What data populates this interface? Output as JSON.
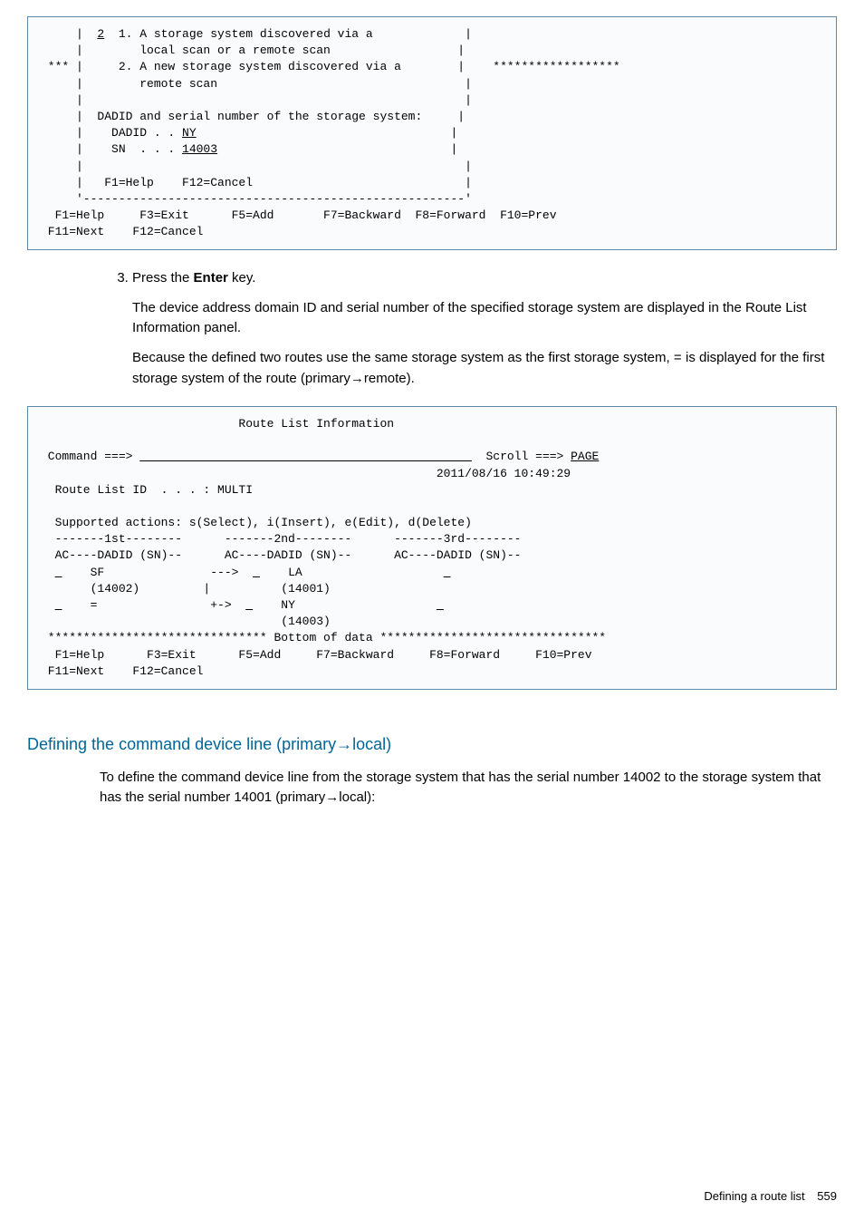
{
  "term1": {
    "l1": "     |  ",
    "l1a": "2",
    "l1b": "  1. A storage system discovered via a             |",
    "l2": "     |        local scan or a remote scan                  |",
    "l3": " *** |     2. A new storage system discovered via a        |    ******************",
    "l4": "     |        remote scan                                   |",
    "l5": "     |                                                      |",
    "l6": "     |  DADID and serial number of the storage system:     |",
    "l7a": "     |    DADID . . ",
    "l7b": "NY",
    "l7c": "                                    |",
    "l8a": "     |    SN  . . . ",
    "l8b": "14003",
    "l8c": "                                 |",
    "l9": "     |                                                      |",
    "l10": "     |   F1=Help    F12=Cancel                              |",
    "l11": "     '------------------------------------------------------'",
    "l12": "  F1=Help     F3=Exit      F5=Add       F7=Backward  F8=Forward  F10=Prev",
    "l13": " F11=Next    F12=Cancel"
  },
  "step3_intro": "Press the ",
  "step3_bold": "Enter",
  "step3_rest": " key.",
  "step3_p1": "The device address domain ID and serial number of the specified storage system are displayed in the Route List Information panel.",
  "step3_p2a": "Because the defined two routes use the same storage system as the first storage system, ",
  "step3_p2eq": "=",
  "step3_p2b": " is displayed for the first storage system of the route (primary→remote).",
  "term2": {
    "l1": "                            Route List Information",
    "blank": " ",
    "l2a": " Command ===> ",
    "l2b": "                                               ",
    "l2c": "  Scroll ===> ",
    "l2d": "PAGE",
    "l3": "                                                        2011/08/16 10:49:29",
    "l4": "  Route List ID  . . . : MULTI",
    "l5": "  Supported actions: s(Select), i(Insert), e(Edit), d(Delete)",
    "l6": "  -------1st--------      -------2nd--------      -------3rd--------",
    "l7": "  AC----DADID (SN)--      AC----DADID (SN)--      AC----DADID (SN)--",
    "l8a": "  ",
    "l8u": "_",
    "l8b": "    SF               --->  ",
    "l8u2": "_",
    "l8c": "    LA                    ",
    "l8u3": "_",
    "l9": "       (14002)         |          (14001)",
    "l10a": "  ",
    "l10u": "_",
    "l10b": "    =                +->  ",
    "l10u2": "_",
    "l10c": "    NY                    ",
    "l10u3": "_",
    "l11": "                                  (14003)",
    "l12": " ******************************* Bottom of data ********************************",
    "l13": "  F1=Help      F3=Exit      F5=Add     F7=Backward     F8=Forward     F10=Prev",
    "l14": " F11=Next    F12=Cancel"
  },
  "heading2": "Defining the command device line (primary→local)",
  "body2": "To define the command device line from the storage system that has the serial number 14002 to the storage system that has the serial number 14001 (primary→local):",
  "footer_text": "Defining a route list",
  "footer_page": "559"
}
